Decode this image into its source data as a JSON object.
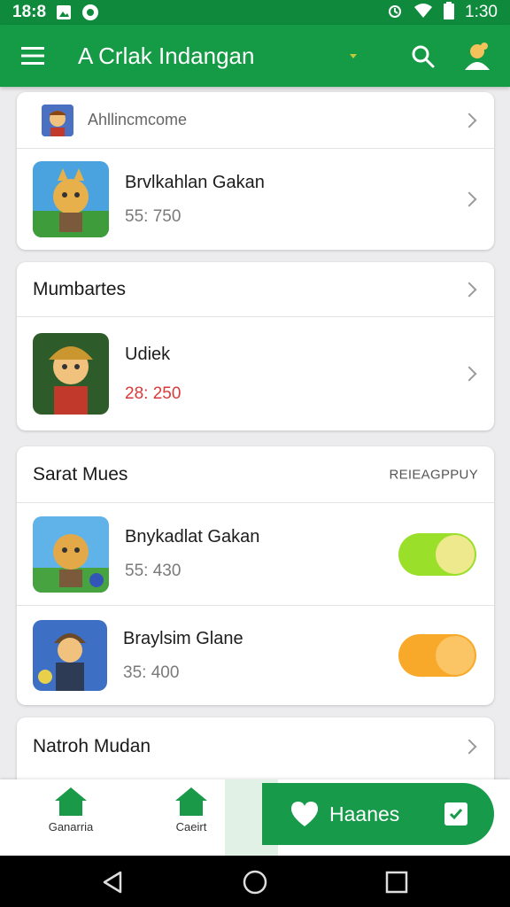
{
  "status_bar": {
    "time_left": "18:8",
    "time_right": "1:30",
    "icons": [
      "photo-icon",
      "record-icon",
      "alarm-icon",
      "wifi-icon",
      "battery-icon"
    ]
  },
  "app_bar": {
    "title": "A Crlak Indangan",
    "icons": [
      "menu-icon",
      "caret-icon",
      "search-icon",
      "profile-icon"
    ]
  },
  "cards": [
    {
      "header": "Ahllincmcome",
      "items": [
        {
          "title": "Brvlkahlan Gakan",
          "subtitle": "55: 750",
          "subtitle_color": "gray"
        }
      ]
    },
    {
      "header": "Mumbartes",
      "items": [
        {
          "title": "Udiek",
          "subtitle": "28: 250",
          "subtitle_color": "red"
        }
      ]
    },
    {
      "header": "Sarat Mues",
      "header_action": "REIEAGPPUY",
      "items": [
        {
          "title": "Bnykadlat Gakan",
          "subtitle": "55: 430",
          "toggle": "on",
          "toggle_color": "#9adf2a"
        },
        {
          "title": "Braylsim Glane",
          "subtitle": "35: 400",
          "toggle": "on",
          "toggle_color": "#f9a92a"
        }
      ]
    },
    {
      "header": "Natroh Mudan"
    }
  ],
  "bottom_nav": {
    "items": [
      {
        "label": "Ganarria",
        "icon": "home-icon"
      },
      {
        "label": "Caeirt",
        "icon": "home-icon"
      }
    ],
    "active": {
      "label": "Haanes",
      "icon": "heart-icon",
      "badge_icon": "check-icon"
    }
  },
  "colors": {
    "primary": "#159a45",
    "status_bar": "#0f8a3c",
    "accent_red": "#d83a3a",
    "toggle_green": "#9adf2a",
    "toggle_orange": "#f9a92a"
  }
}
